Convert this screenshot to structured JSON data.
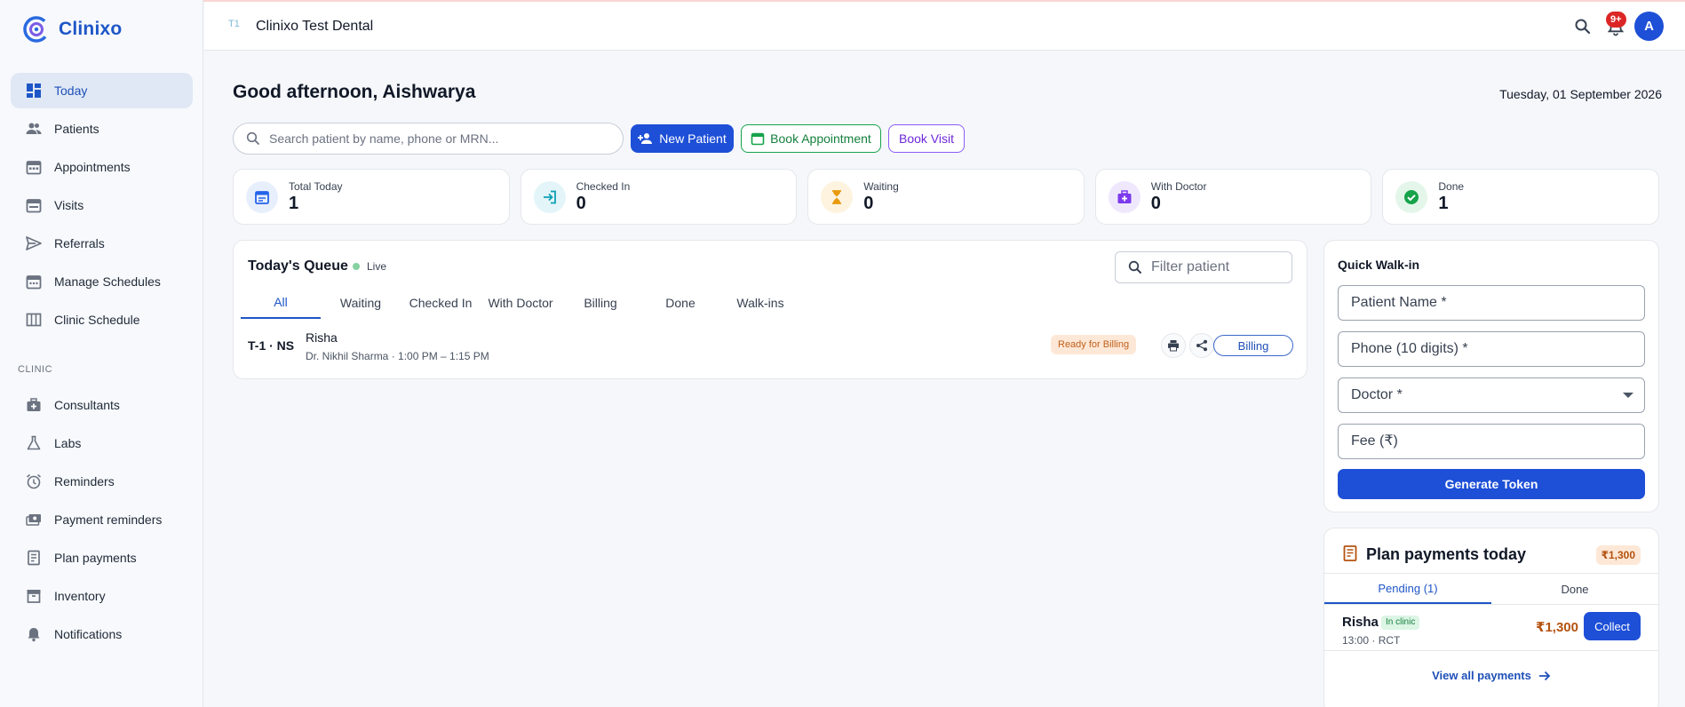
{
  "brand": {
    "name": "Clinixo"
  },
  "sidebar": {
    "items": [
      {
        "label": "Today",
        "icon": "dashboard-icon"
      },
      {
        "label": "Patients",
        "icon": "people-icon"
      },
      {
        "label": "Appointments",
        "icon": "calendar-icon"
      },
      {
        "label": "Visits",
        "icon": "calendar-check-icon"
      },
      {
        "label": "Referrals",
        "icon": "send-icon"
      },
      {
        "label": "Manage Schedules",
        "icon": "calendar-edit-icon"
      },
      {
        "label": "Clinic Schedule",
        "icon": "table-icon"
      }
    ],
    "section_label": "CLINIC",
    "clinic_items": [
      {
        "label": "Consultants",
        "icon": "medical-bag-icon"
      },
      {
        "label": "Labs",
        "icon": "flask-icon"
      },
      {
        "label": "Reminders",
        "icon": "alarm-icon"
      },
      {
        "label": "Payment reminders",
        "icon": "payments-icon"
      },
      {
        "label": "Plan payments",
        "icon": "receipt-icon"
      },
      {
        "label": "Inventory",
        "icon": "archive-icon"
      },
      {
        "label": "Notifications",
        "icon": "bell-icon"
      }
    ]
  },
  "header": {
    "clinic_icon_text": "T1",
    "clinic_name": "Clinixo Test Dental",
    "notification_badge": "9+",
    "avatar_initial": "A"
  },
  "main": {
    "greeting": "Good afternoon, Aishwarya",
    "date": "Tuesday, 01 September 2026",
    "search_placeholder": "Search patient by name, phone or MRN...",
    "actions": {
      "new_patient": "New Patient",
      "book_appointment": "Book Appointment",
      "book_visit": "Book Visit"
    },
    "stats": [
      {
        "label": "Total Today",
        "value": "1",
        "color": "#2563eb",
        "bg": "#e8effc",
        "icon": "calendar-icon"
      },
      {
        "label": "Checked In",
        "value": "0",
        "color": "#0e9fb5",
        "bg": "#e3f5f8",
        "icon": "login-icon"
      },
      {
        "label": "Waiting",
        "value": "0",
        "color": "#e89a0c",
        "bg": "#fdf3df",
        "icon": "hourglass-icon"
      },
      {
        "label": "With Doctor",
        "value": "0",
        "color": "#7c3aed",
        "bg": "#efe8fd",
        "icon": "medical-bag-icon"
      },
      {
        "label": "Done",
        "value": "1",
        "color": "#16a34a",
        "bg": "#e4f6ea",
        "icon": "check-circle-icon"
      }
    ]
  },
  "queue": {
    "title": "Today's Queue",
    "live": "Live",
    "filter_placeholder": "Filter patient",
    "tabs": [
      "All",
      "Waiting",
      "Checked In",
      "With Doctor",
      "Billing",
      "Done",
      "Walk-ins"
    ],
    "rows": [
      {
        "token": "T-1 · NS",
        "name": "Risha",
        "detail": "Dr. Nikhil Sharma · 1:00 PM – 1:15 PM",
        "status": "Ready for Billing",
        "action": "Billing"
      }
    ]
  },
  "walkin": {
    "title": "Quick Walk-in",
    "patient_name_placeholder": "Patient Name *",
    "phone_placeholder": "Phone (10 digits) *",
    "doctor_label": "Doctor *",
    "fee_placeholder": "Fee (₹)",
    "submit": "Generate Token"
  },
  "plan_payments": {
    "title": "Plan payments today",
    "total": "₹1,300",
    "tabs": [
      "Pending (1)",
      "Done"
    ],
    "rows": [
      {
        "name": "Risha",
        "tag": "In clinic",
        "sub": "13:00 · RCT",
        "amount": "₹1,300",
        "action": "Collect"
      }
    ],
    "view_all": "View all payments"
  }
}
